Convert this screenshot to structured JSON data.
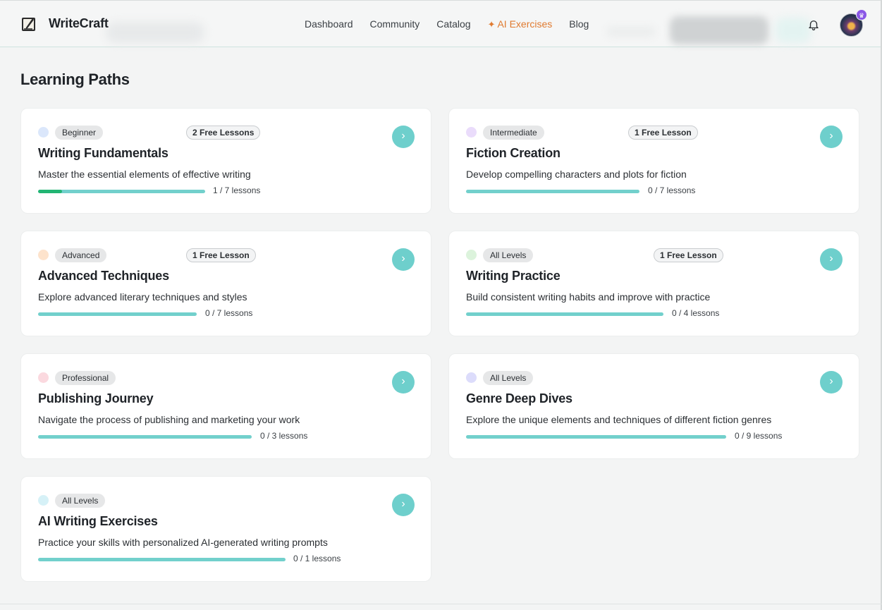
{
  "header": {
    "brand": "WriteCraft",
    "nav": [
      {
        "label": "Dashboard",
        "active": false
      },
      {
        "label": "Community",
        "active": false
      },
      {
        "label": "Catalog",
        "active": false
      },
      {
        "label": "AI Exercises",
        "active": true,
        "icon": "sparkle-icon"
      },
      {
        "label": "Blog",
        "active": false
      }
    ],
    "icons": {
      "logo": "quill-book-icon",
      "notifications": "bell-icon",
      "avatar_badge": "crown-icon"
    }
  },
  "main": {
    "title": "Learning Paths",
    "paths": [
      {
        "level": "Beginner",
        "dot_color": "#dbe7fb",
        "free": "2 Free Lessons",
        "title": "Writing Fundamentals",
        "description": "Master the essential elements of effective writing",
        "progress": "1 / 7 lessons",
        "completed": 1,
        "total": 7
      },
      {
        "level": "Intermediate",
        "dot_color": "#eadcfb",
        "free": "1 Free Lesson",
        "title": "Fiction Creation",
        "description": "Develop compelling characters and plots for fiction",
        "progress": "0 / 7 lessons",
        "completed": 0,
        "total": 7
      },
      {
        "level": "Advanced",
        "dot_color": "#fde3cc",
        "free": "1 Free Lesson",
        "title": "Advanced Techniques",
        "description": "Explore advanced literary techniques and styles",
        "progress": "0 / 7 lessons",
        "completed": 0,
        "total": 7
      },
      {
        "level": "All Levels",
        "dot_color": "#dcf3dc",
        "free": "1 Free Lesson",
        "title": "Writing Practice",
        "description": "Build consistent writing habits and improve with practice",
        "progress": "0 / 4 lessons",
        "completed": 0,
        "total": 4
      },
      {
        "level": "Professional",
        "dot_color": "#fbd9df",
        "free": "",
        "title": "Publishing Journey",
        "description": "Navigate the process of publishing and marketing your work",
        "progress": "0 / 3 lessons",
        "completed": 0,
        "total": 3
      },
      {
        "level": "All Levels",
        "dot_color": "#dcdcfb",
        "free": "",
        "title": "Genre Deep Dives",
        "description": "Explore the unique elements and techniques of different fiction genres",
        "progress": "0 / 9 lessons",
        "completed": 0,
        "total": 9
      },
      {
        "level": "All Levels",
        "dot_color": "#d6f1f7",
        "free": "",
        "title": "AI Writing Exercises",
        "description": "Practice your skills with personalized AI-generated writing prompts",
        "progress": "0 / 1 lessons",
        "completed": 0,
        "total": 1
      }
    ]
  },
  "colors": {
    "accent": "#6ecfcc",
    "progress_done": "#22b573",
    "active_nav": "#e07a2f"
  }
}
